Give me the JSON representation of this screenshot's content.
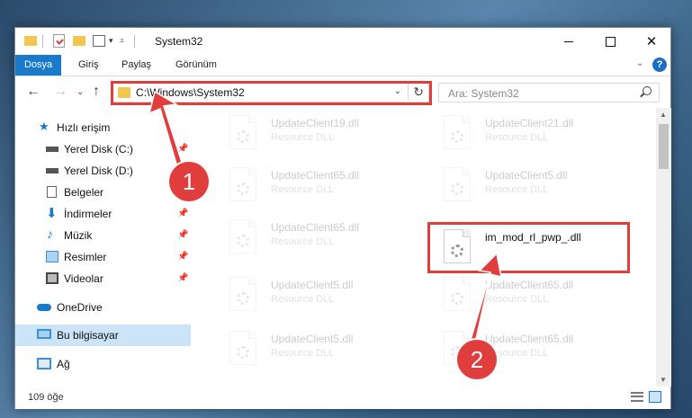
{
  "window": {
    "title": "System32"
  },
  "ribbon": {
    "tabs": [
      {
        "label": "Dosya",
        "active": true
      },
      {
        "label": "Giriş",
        "active": false
      },
      {
        "label": "Paylaş",
        "active": false
      },
      {
        "label": "Görünüm",
        "active": false
      }
    ],
    "help": "?"
  },
  "nav": {
    "address": "C:\\Windows\\System32",
    "search_placeholder": "Ara: System32"
  },
  "sidebar": {
    "items": [
      {
        "label": "Hızlı erişim",
        "icon": "star-icon",
        "pinned": false
      },
      {
        "label": "Yerel Disk (C:)",
        "icon": "drive-icon",
        "pinned": true
      },
      {
        "label": "Yerel Disk (D:)",
        "icon": "drive-icon",
        "pinned": true
      },
      {
        "label": "Belgeler",
        "icon": "document-icon",
        "pinned": true
      },
      {
        "label": "İndirmeler",
        "icon": "download-icon",
        "pinned": true
      },
      {
        "label": "Müzik",
        "icon": "music-icon",
        "pinned": true
      },
      {
        "label": "Resimler",
        "icon": "pictures-icon",
        "pinned": true
      },
      {
        "label": "Videolar",
        "icon": "video-icon",
        "pinned": true
      },
      {
        "label": "OneDrive",
        "icon": "cloud-icon",
        "pinned": false
      },
      {
        "label": "Bu bilgisayar",
        "icon": "computer-icon",
        "pinned": false,
        "selected": true
      },
      {
        "label": "Ağ",
        "icon": "network-icon",
        "pinned": false
      }
    ]
  },
  "files": [
    {
      "name": "UpdateClient19.dll",
      "type": "Resource DLL",
      "faded": true
    },
    {
      "name": "UpdateClient21.dll",
      "type": "Resource DLL",
      "faded": true
    },
    {
      "name": "UpdateClient65.dll",
      "type": "Resource DLL",
      "faded": true
    },
    {
      "name": "UpdateClient5.dll",
      "type": "Resource DLL",
      "faded": true
    },
    {
      "name": "UpdateClient65.dll",
      "type": "Resource DLL",
      "faded": true
    },
    {
      "name": "im_mod_rl_pwp_.dll",
      "type": "",
      "faded": false
    },
    {
      "name": "UpdateClient5.dll",
      "type": "Resource DLL",
      "faded": true
    },
    {
      "name": "UpdateClient65.dll",
      "type": "Resource DLL",
      "faded": true
    },
    {
      "name": "UpdateClient5.dll",
      "type": "Resource DLL",
      "faded": true
    },
    {
      "name": "UpdateClient65.dll",
      "type": "Resource DLL",
      "faded": true
    }
  ],
  "status": {
    "item_count": "109 öğe"
  },
  "callouts": {
    "one": "1",
    "two": "2"
  },
  "colors": {
    "accent": "#1979ca",
    "highlight": "#e03d3d",
    "folder": "#f3c64f",
    "selected": "#cce4f7"
  }
}
